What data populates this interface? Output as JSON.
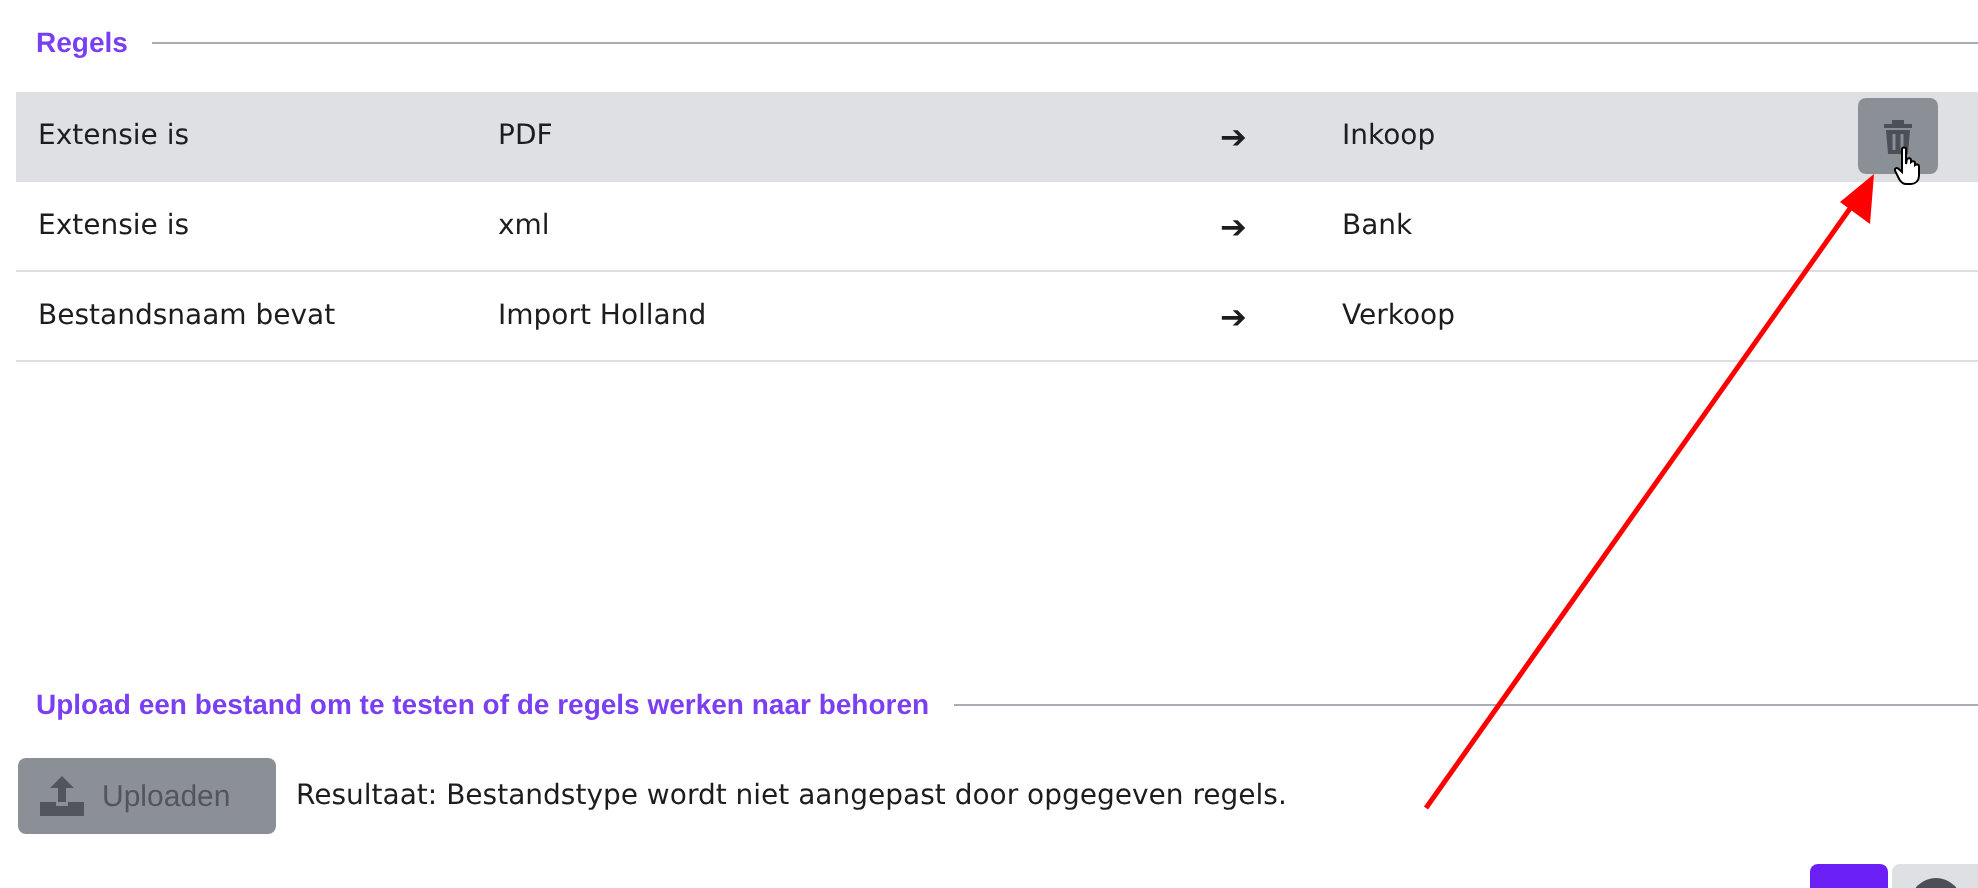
{
  "rules_section": {
    "title": "Regels"
  },
  "rules": [
    {
      "condition": "Extensie is",
      "value": "PDF",
      "arrow": "➔",
      "target": "Inkoop",
      "hovered": true
    },
    {
      "condition": "Extensie is",
      "value": "xml",
      "arrow": "➔",
      "target": "Bank",
      "hovered": false
    },
    {
      "condition": "Bestandsnaam bevat",
      "value": "Import Holland",
      "arrow": "➔",
      "target": "Verkoop",
      "hovered": false
    }
  ],
  "upload_section": {
    "title": "Upload een bestand om te testen of de regels werken naar behoren",
    "button": {
      "label": "Uploaden",
      "disabled": true
    },
    "result": "Resultaat: Bestandstype wordt niet aangepast door opgegeven regels."
  },
  "annotation": {
    "kind": "arrow",
    "color": "#ff0000"
  }
}
